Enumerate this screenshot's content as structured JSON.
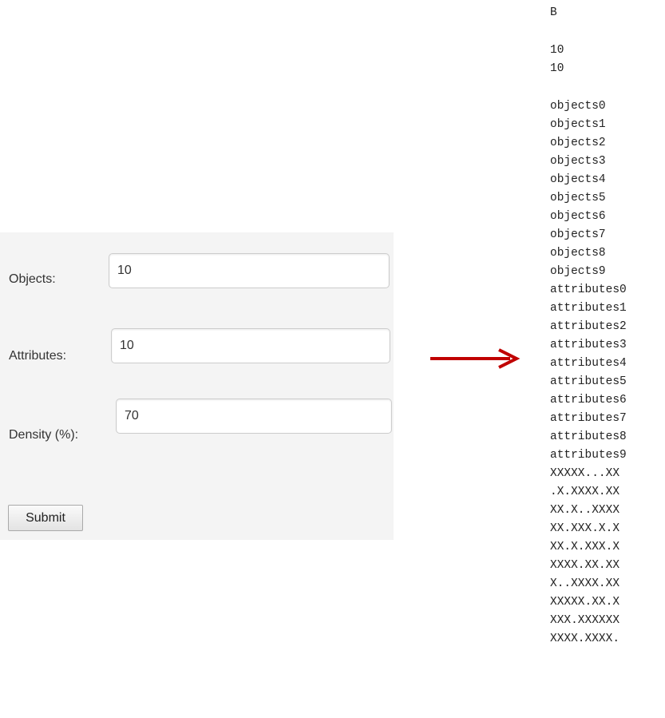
{
  "form": {
    "objects_label": "Objects:",
    "objects_value": "10",
    "attributes_label": "Attributes:",
    "attributes_value": "10",
    "density_label": "Density (%):",
    "density_value": "70",
    "submit_label": "Submit"
  },
  "arrow": {
    "icon": "arrow-right-icon",
    "color": "#c00000"
  },
  "output": {
    "header": "B",
    "object_count": "10",
    "attribute_count": "10",
    "objects": [
      "objects0",
      "objects1",
      "objects2",
      "objects3",
      "objects4",
      "objects5",
      "objects6",
      "objects7",
      "objects8",
      "objects9"
    ],
    "attributes": [
      "attributes0",
      "attributes1",
      "attributes2",
      "attributes3",
      "attributes4",
      "attributes5",
      "attributes6",
      "attributes7",
      "attributes8",
      "attributes9"
    ],
    "matrix": [
      "XXXXX...XX",
      ".X.XXXX.XX",
      "XX.X..XXXX",
      "XX.XXX.X.X",
      "XX.X.XXX.X",
      "XXXX.XX.XX",
      "X..XXXX.XX",
      "XXXXX.XX.X",
      "XXX.XXXXXX",
      "XXXX.XXXX."
    ]
  }
}
